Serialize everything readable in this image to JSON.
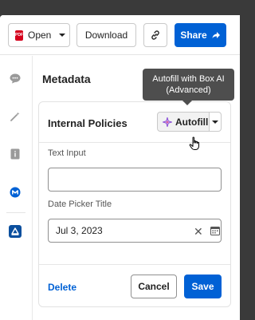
{
  "toolbar": {
    "open_label": "Open",
    "pdf_badge": "PDF",
    "download_label": "Download",
    "share_label": "Share"
  },
  "metadata": {
    "title": "Metadata"
  },
  "tooltip": {
    "text": "Autofill with Box AI (Advanced)"
  },
  "card": {
    "title": "Internal Policies",
    "autofill_label": "Autofill",
    "text_input_label": "Text Input",
    "text_input_value": "",
    "date_label": "Date Picker Title",
    "date_value": "Jul 3, 2023",
    "delete_label": "Delete",
    "cancel_label": "Cancel",
    "save_label": "Save"
  },
  "colors": {
    "brand_blue": "#0061d5",
    "pdf_red": "#d5001c",
    "tooltip_bg": "#4e4e4e"
  },
  "icons": {
    "rail": [
      "comment-icon",
      "magic-wand-icon",
      "file-info-icon",
      "box-ai-icon",
      "metadata-icon"
    ],
    "toolbar": [
      "pdf-icon",
      "chevron-down-icon",
      "link-icon",
      "share-arrow-icon"
    ],
    "card": [
      "ai-sparkle-icon",
      "chevron-down-icon",
      "clear-icon",
      "calendar-icon"
    ]
  }
}
